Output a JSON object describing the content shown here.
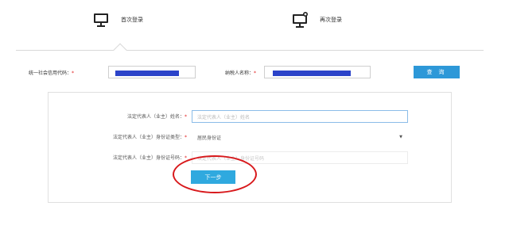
{
  "tabs": {
    "first_login": {
      "label": "首次登录",
      "icon": "desktop-monitor-icon"
    },
    "relogin": {
      "label": "再次登录",
      "icon": "desktop-monitor-badge-icon"
    }
  },
  "search": {
    "credit_code_label": "统一社会信用代码：",
    "credit_code_required": "*",
    "taxpayer_name_label": "纳税人名称：",
    "taxpayer_name_required": "*",
    "query_button": "查 询",
    "redaction_color": "#2b43c9"
  },
  "form": {
    "legal_rep_name_label": "法定代表人（业主）姓名：",
    "legal_rep_name_required": "*",
    "legal_rep_name_placeholder": "法定代表人（业主）姓名",
    "id_type_label": "法定代表人（业主）身份证类型：",
    "id_type_required": "*",
    "id_type_value": "居民身份证",
    "id_number_label": "法定代表人（业主）身份证号码：",
    "id_number_required": "*",
    "id_number_placeholder": "法定代表人（业主）身份证号码",
    "next_button": "下一步"
  },
  "colors": {
    "accent": "#2d98d8",
    "required": "#e02020",
    "highlight": "#d8191c"
  }
}
